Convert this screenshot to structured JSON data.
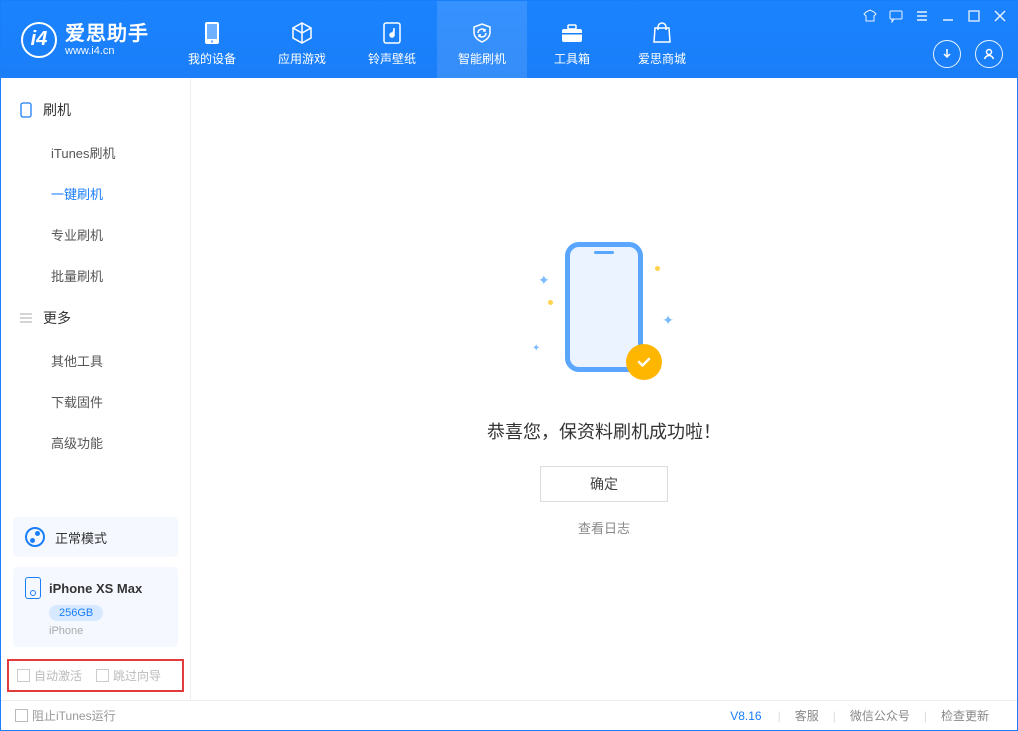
{
  "app": {
    "title": "爱思助手",
    "url": "www.i4.cn"
  },
  "nav": {
    "items": [
      {
        "label": "我的设备"
      },
      {
        "label": "应用游戏"
      },
      {
        "label": "铃声壁纸"
      },
      {
        "label": "智能刷机"
      },
      {
        "label": "工具箱"
      },
      {
        "label": "爱思商城"
      }
    ],
    "active_index": 3
  },
  "sidebar": {
    "section1": {
      "title": "刷机",
      "items": [
        {
          "label": "iTunes刷机"
        },
        {
          "label": "一键刷机"
        },
        {
          "label": "专业刷机"
        },
        {
          "label": "批量刷机"
        }
      ],
      "active_index": 1
    },
    "section2": {
      "title": "更多",
      "items": [
        {
          "label": "其他工具"
        },
        {
          "label": "下载固件"
        },
        {
          "label": "高级功能"
        }
      ]
    },
    "mode": {
      "label": "正常模式"
    },
    "device": {
      "name": "iPhone XS Max",
      "capacity": "256GB",
      "type": "iPhone"
    },
    "checks": {
      "auto_activate": "自动激活",
      "skip_guide": "跳过向导"
    }
  },
  "main": {
    "message": "恭喜您，保资料刷机成功啦！",
    "ok_label": "确定",
    "log_link": "查看日志"
  },
  "footer": {
    "block_itunes": "阻止iTunes运行",
    "version": "V8.16",
    "links": {
      "support": "客服",
      "wechat": "微信公众号",
      "update": "检查更新"
    }
  }
}
